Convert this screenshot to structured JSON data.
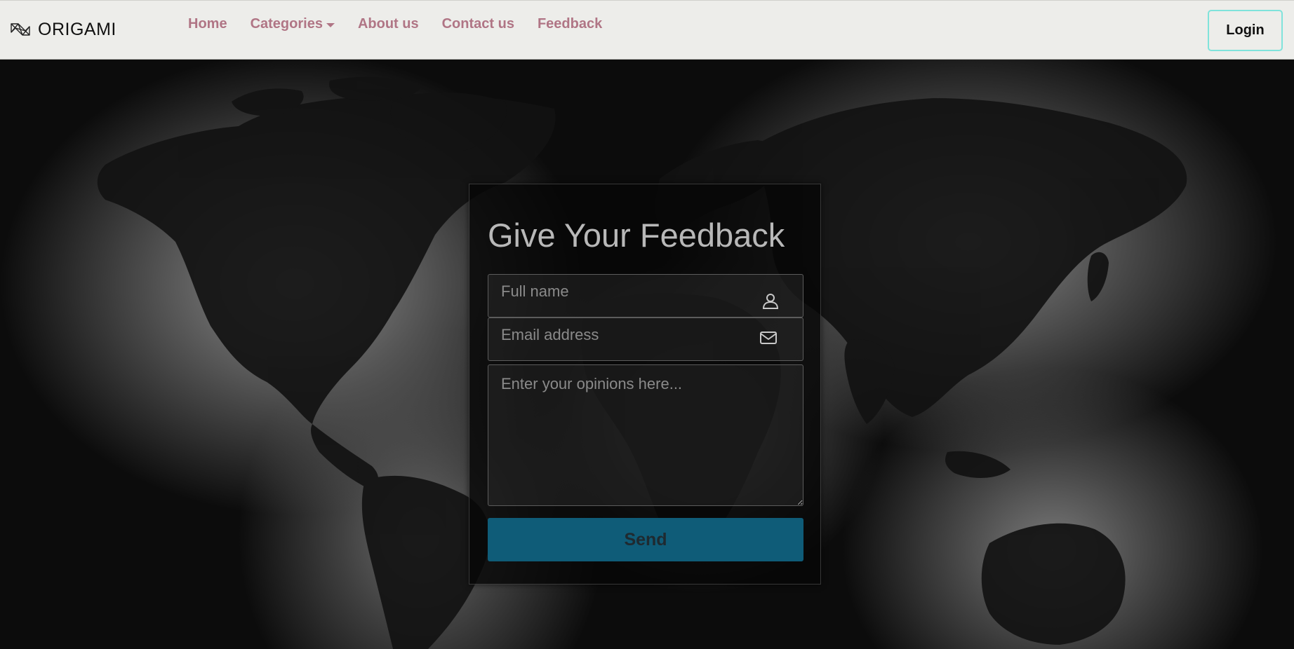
{
  "brand": {
    "name": "ORIGAMI",
    "icon": "origami-logo-icon"
  },
  "nav": {
    "items": [
      {
        "label": "Home"
      },
      {
        "label": "Categories",
        "has_dropdown": true
      },
      {
        "label": "About us"
      },
      {
        "label": "Contact us"
      },
      {
        "label": "Feedback"
      }
    ],
    "login_label": "Login"
  },
  "form": {
    "title": "Give Your Feedback",
    "name_placeholder": "Full name",
    "name_icon": "user-icon",
    "email_placeholder": "Email address",
    "email_icon": "envelope-icon",
    "message_placeholder": "Enter your opinions here...",
    "submit_label": "Send"
  },
  "colors": {
    "nav_link": "#b07585",
    "login_border": "#7fe3db",
    "send_button": "#0f5c78",
    "navbar_bg": "#ededea"
  },
  "background": {
    "description_icon": "world-map-background"
  }
}
